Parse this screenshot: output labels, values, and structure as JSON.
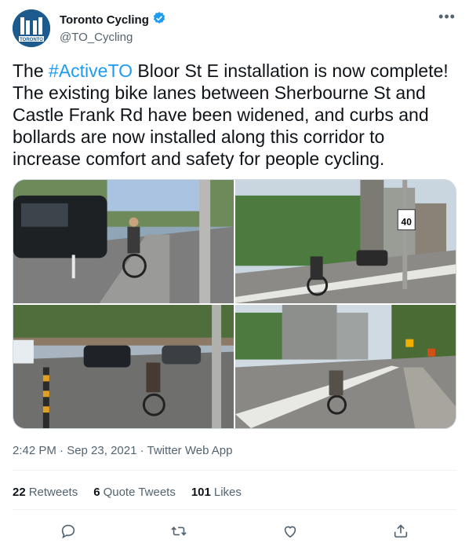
{
  "author": {
    "display_name": "Toronto Cycling",
    "handle": "@TO_Cycling",
    "avatar_text": "TORONTO",
    "verified_icon": "verified-badge-icon"
  },
  "menu_icon": "more-options-icon",
  "more_glyph": "•••",
  "tweet": {
    "text_before": "The ",
    "hashtag": "#ActiveTO",
    "text_after": " Bloor St E installation is now complete! The existing bike lanes between Sherbourne St and Castle Frank Rd have been widened, and curbs and bollards are now installed along this corridor to increase comfort and safety for people cycling."
  },
  "media": {
    "photos": [
      {
        "name": "photo-1",
        "sign_text": ""
      },
      {
        "name": "photo-2",
        "sign_text": "40"
      },
      {
        "name": "photo-3",
        "sign_text": ""
      },
      {
        "name": "photo-4",
        "sign_text": ""
      }
    ]
  },
  "meta": {
    "timestamp": "2:42 PM · Sep 23, 2021 · Twitter Web App"
  },
  "stats": {
    "retweets_count": "22",
    "retweets_label": "Retweets",
    "quotes_count": "6",
    "quotes_label": "Quote Tweets",
    "likes_count": "101",
    "likes_label": "Likes"
  },
  "actions": [
    "reply-icon",
    "retweet-icon",
    "like-icon",
    "share-icon"
  ],
  "colors": {
    "accent": "#1d9bf0",
    "text": "#0f1419",
    "secondary": "#536471",
    "border": "#eff3f4"
  }
}
